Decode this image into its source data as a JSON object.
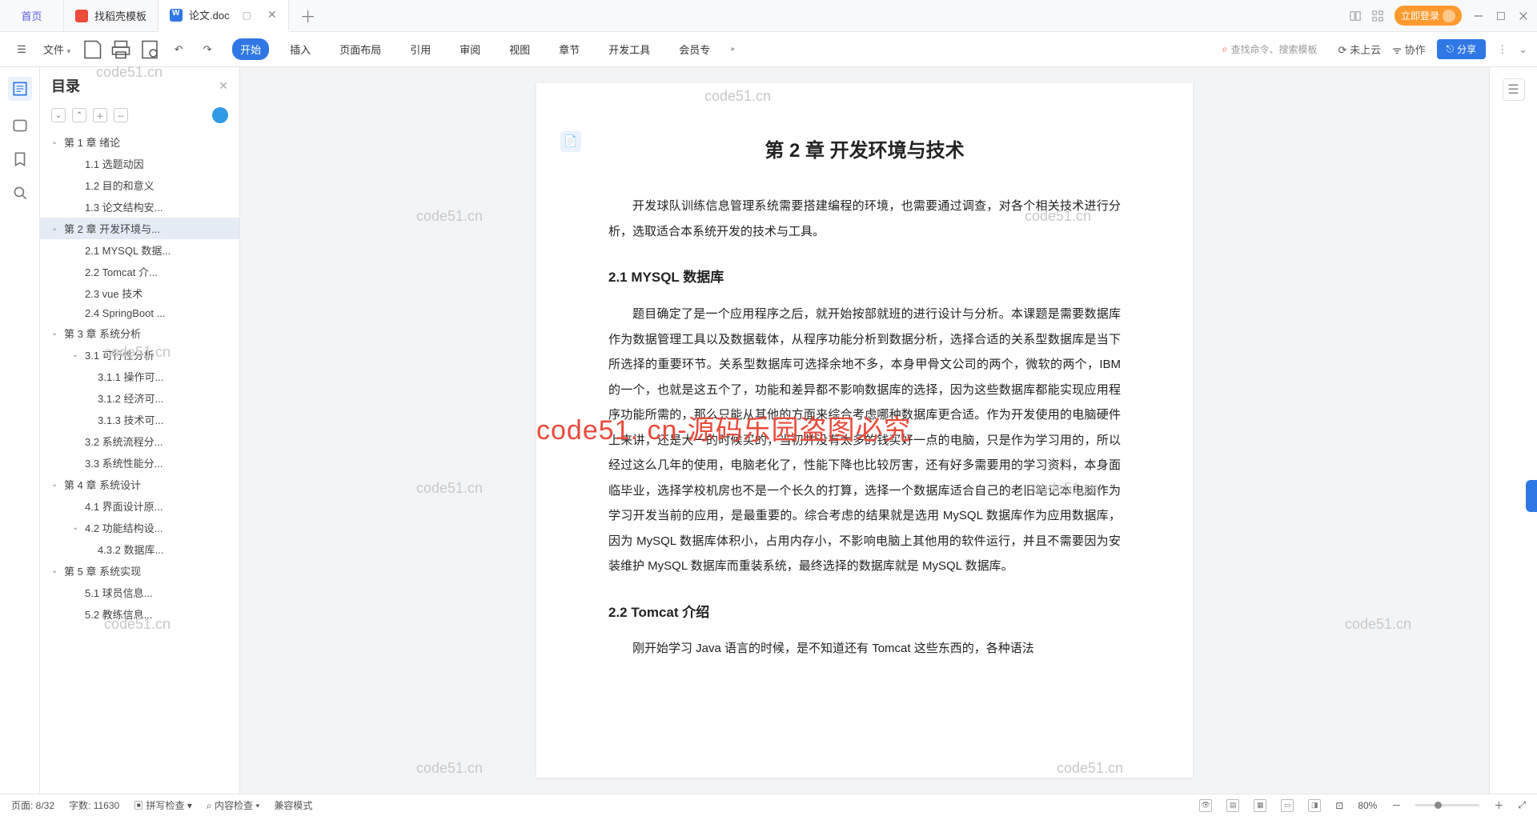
{
  "tabs": {
    "home": "首页",
    "t1": "找稻壳模板",
    "t2": "论文.doc"
  },
  "login": "立即登录",
  "file_menu": "文件",
  "ribbon_tabs": [
    "开始",
    "插入",
    "页面布局",
    "引用",
    "审阅",
    "视图",
    "章节",
    "开发工具",
    "会员专"
  ],
  "search_ph": "查找命令、搜索模板",
  "cloud": "未上云",
  "collab": "协作",
  "share": "分享",
  "outline": {
    "title": "目录",
    "items": [
      {
        "lvl": 1,
        "chev": true,
        "label": "第 1 章 绪论"
      },
      {
        "lvl": 2,
        "label": "1.1 选题动因"
      },
      {
        "lvl": 2,
        "label": "1.2 目的和意义"
      },
      {
        "lvl": 2,
        "label": "1.3 论文结构安..."
      },
      {
        "lvl": 1,
        "chev": true,
        "sel": true,
        "label": "第 2 章 开发环境与..."
      },
      {
        "lvl": 2,
        "label": "2.1 MYSQL 数据..."
      },
      {
        "lvl": 2,
        "label": "2.2 Tomcat 介..."
      },
      {
        "lvl": 2,
        "label": "2.3 vue 技术"
      },
      {
        "lvl": 2,
        "label": "2.4 SpringBoot ..."
      },
      {
        "lvl": 1,
        "chev": true,
        "label": "第 3 章 系统分析"
      },
      {
        "lvl": 2,
        "chev": true,
        "label": "3.1 可行性分析"
      },
      {
        "lvl": 3,
        "label": "3.1.1 操作可..."
      },
      {
        "lvl": 3,
        "label": "3.1.2 经济可..."
      },
      {
        "lvl": 3,
        "label": "3.1.3 技术可..."
      },
      {
        "lvl": 2,
        "label": "3.2 系统流程分..."
      },
      {
        "lvl": 2,
        "label": "3.3 系统性能分..."
      },
      {
        "lvl": 1,
        "chev": true,
        "label": "第 4 章 系统设计"
      },
      {
        "lvl": 2,
        "label": "4.1 界面设计原..."
      },
      {
        "lvl": 2,
        "chev": true,
        "label": "4.2 功能结构设..."
      },
      {
        "lvl": 3,
        "label": "4.3.2 数据库..."
      },
      {
        "lvl": 1,
        "chev": true,
        "label": "第 5 章 系统实现"
      },
      {
        "lvl": 2,
        "label": "5.1 球员信息..."
      },
      {
        "lvl": 2,
        "label": "5.2 教练信息..."
      }
    ]
  },
  "doc": {
    "chapter": "第 2 章  开发环境与技术",
    "intro": "开发球队训练信息管理系统需要搭建编程的环境，也需要通过调查，对各个相关技术进行分析，选取适合本系统开发的技术与工具。",
    "s1_title": "2.1 MYSQL 数据库",
    "s1_body": "题目确定了是一个应用程序之后，就开始按部就班的进行设计与分析。本课题是需要数据库作为数据管理工具以及数据载体，从程序功能分析到数据分析，选择合适的关系型数据库是当下所选择的重要环节。关系型数据库可选择余地不多，本身甲骨文公司的两个，微软的两个，IBM 的一个，也就是这五个了，功能和差异都不影响数据库的选择，因为这些数据库都能实现应用程序功能所需的，那么只能从其他的方面来综合考虑哪种数据库更合适。作为开发使用的电脑硬件上来讲，还是大一的时候买的，当初并没有太多的钱买好一点的电脑，只是作为学习用的，所以经过这么几年的使用，电脑老化了，性能下降也比较厉害，还有好多需要用的学习资料，本身面临毕业，选择学校机房也不是一个长久的打算，选择一个数据库适合自己的老旧笔记本电脑作为学习开发当前的应用，是最重要的。综合考虑的结果就是选用 MySQL 数据库作为应用数据库，因为 MySQL 数据库体积小，占用内存小，不影响电脑上其他用的软件运行，并且不需要因为安装维护 MySQL 数据库而重装系统，最终选择的数据库就是 MySQL 数据库。",
    "s2_title": "2.2 Tomcat  介绍",
    "s2_body": "刚开始学习 Java 语言的时候，是不知道还有 Tomcat 这些东西的，各种语法"
  },
  "status": {
    "page": "页面: 8/32",
    "words": "字数: 11630",
    "spell": "拼写检查",
    "content": "内容检查",
    "compat": "兼容模式",
    "zoom": "80%"
  },
  "wm": "code51.cn",
  "wm_red": "code51. cn-源码乐园盗图必究"
}
